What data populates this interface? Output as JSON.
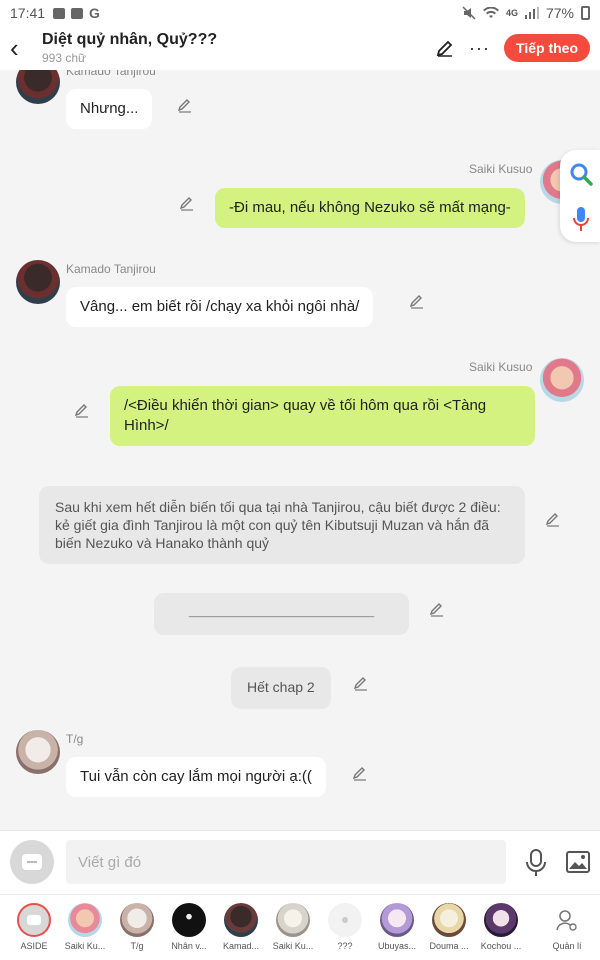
{
  "status": {
    "time": "17:41",
    "battery": "77%",
    "network": "4G"
  },
  "header": {
    "title": "Diệt quỷ nhân, Quỷ???",
    "subtitle": "993 chữ",
    "follow_label": "Tiếp theo"
  },
  "messages": [
    {
      "speaker": "Kamado Tanjirou",
      "text": "Nhưng..."
    },
    {
      "speaker": "Saiki Kusuo",
      "text": "-Đi mau, nếu không Nezuko sẽ mất mạng-"
    },
    {
      "speaker": "Kamado Tanjirou",
      "text": "Vâng... em biết rồi /chạy xa khỏi ngôi nhà/"
    },
    {
      "speaker": "Saiki Kusuo",
      "text": "/<Điều khiển thời gian> quay về tối hôm qua rồi <Tàng Hình>/"
    },
    {
      "speaker": "",
      "text": "Sau khi xem hết diễn biến tối qua tại nhà Tanjirou, cậu biết được 2 điều: kẻ giết gia đình Tanjirou là một con quỷ tên Kibutsuji Muzan và hắn đã biến Nezuko và Hanako thành quỷ"
    },
    {
      "speaker": "",
      "text": "_____________________________________"
    },
    {
      "speaker": "",
      "text": "Hết chap 2"
    },
    {
      "speaker": "T/g",
      "text": "Tui vẫn còn cay lắm mọi người ạ:(("
    }
  ],
  "input": {
    "placeholder": "Viết gì đó"
  },
  "characters": [
    {
      "name": "ASIDE",
      "color": "#e8504a"
    },
    {
      "name": "Saiki Ku...",
      "color": "#e88a9a"
    },
    {
      "name": "T/g",
      "color": "#c9b3a8"
    },
    {
      "name": "Nhân v...",
      "color": "#111111"
    },
    {
      "name": "Kamad...",
      "color": "#6b3b3b"
    },
    {
      "name": "Saiki Ku...",
      "color": "#d8d4cc"
    },
    {
      "name": "???",
      "color": "#f2f2f2"
    },
    {
      "name": "Ubuyas...",
      "color": "#b59ad8"
    },
    {
      "name": "Douma ...",
      "color": "#e8d8a8"
    },
    {
      "name": "Kochou ...",
      "color": "#5a3a6a"
    },
    {
      "name": "Quản lí",
      "color": "#ffffff"
    }
  ],
  "colors": {
    "accent": "#f44b3f",
    "bubble_right": "#d3f27f",
    "bubble_left": "#ffffff",
    "narration": "#e8e8e8"
  }
}
